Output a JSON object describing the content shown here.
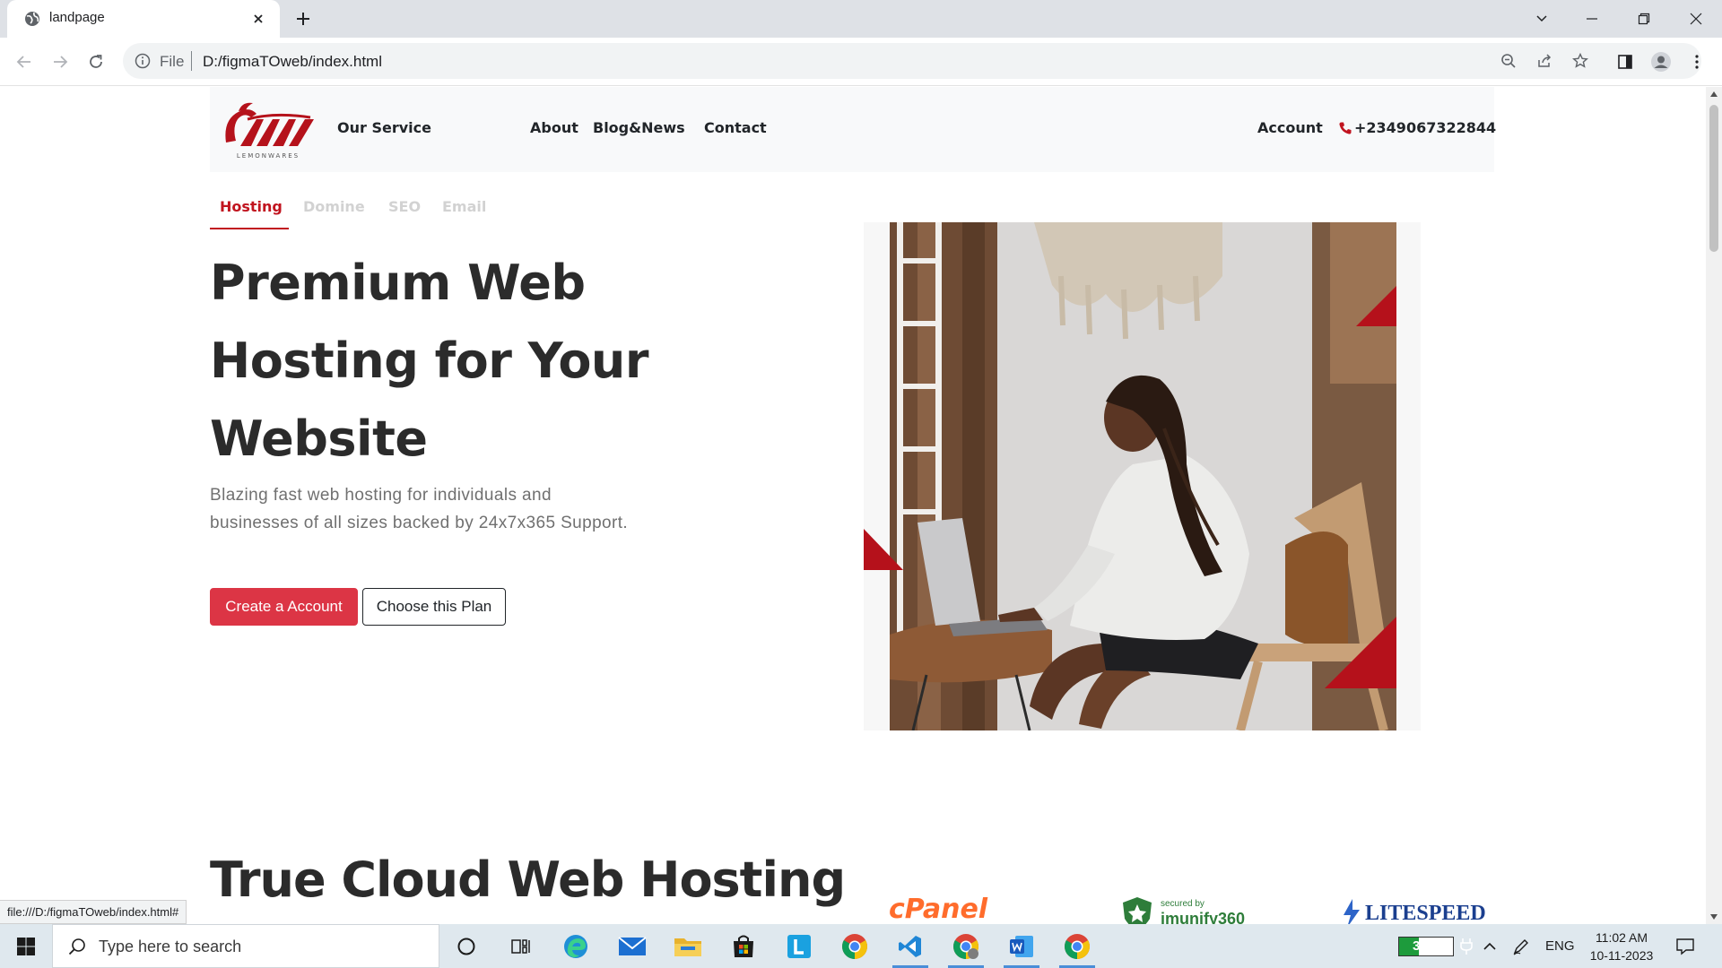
{
  "browser": {
    "tab_title": "landpage",
    "url_scheme": "File",
    "url": "D:/figmaTOweb/index.html",
    "status_url": "file:///D:/figmaTOweb/index.html#"
  },
  "site_nav": {
    "logo_text": "LEMONWARES",
    "links": [
      "Our Service",
      "About",
      "Blog&News",
      "Contact"
    ],
    "account": "Account",
    "phone": "+2349067322844"
  },
  "service_tabs": {
    "items": [
      "Hosting",
      "Domine",
      "SEO",
      "Email"
    ],
    "active": "Hosting"
  },
  "hero": {
    "title_lines": [
      "Premium Web",
      "Hosting for Your",
      "Website"
    ],
    "description_lines": [
      "Blazing fast web hosting for individuals and",
      "businesses of all sizes backed by 24x7x365 Support."
    ],
    "primary_button": "Create a Account",
    "secondary_button": "Choose this Plan"
  },
  "section2": {
    "title": "True Cloud Web Hosting",
    "partners": [
      "cPanel",
      "secured by",
      "imunify360",
      "LITESPEED"
    ]
  },
  "taskbar": {
    "search_placeholder": "Type here to search",
    "battery": "36%",
    "battery_level": 0.36,
    "language": "ENG",
    "time": "11:02 AM",
    "date": "10-11-2023"
  },
  "colors": {
    "brand_red": "#c1141f",
    "button_red": "#dc3545",
    "heading": "#2b2b2b",
    "body_text": "#707070"
  },
  "icons": [
    "globe-icon",
    "close-icon",
    "plus-icon",
    "chevron-down-icon",
    "minimize-icon",
    "maximize-icon",
    "back-icon",
    "forward-icon",
    "reload-icon",
    "info-icon",
    "zoom-icon",
    "share-icon",
    "star-icon",
    "sidepanel-icon",
    "profile-icon",
    "menu-icon",
    "phone-icon",
    "windows-icon",
    "search-icon",
    "cortana-icon",
    "taskview-icon",
    "edge-icon",
    "mail-icon",
    "explorer-icon",
    "store-icon",
    "chrome-icon",
    "vscode-icon",
    "word-icon"
  ]
}
